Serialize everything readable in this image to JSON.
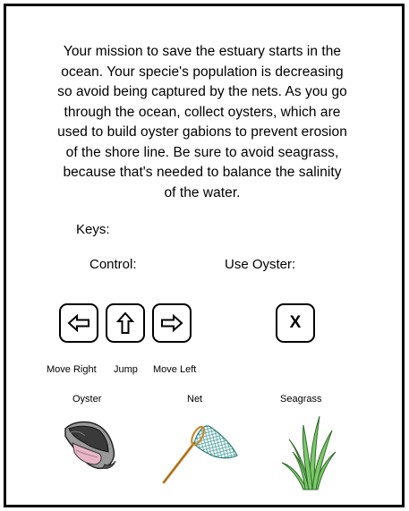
{
  "intro": {
    "lines": [
      "Your mission to save the estuary starts in the",
      "ocean. Your specie's population is decreasing",
      "so avoid being captured by the nets. As you go",
      "through the ocean, collect oysters, which are",
      "used to build oyster gabions to prevent erosion",
      "of the shore line. Be sure to avoid seagrass,",
      "because that's needed to balance the salinity",
      "of the water."
    ]
  },
  "keys_heading": "Keys:",
  "control_label": "Control:",
  "use_oyster_label": "Use Oyster:",
  "controls": {
    "left_caption": "Move Right",
    "up_caption": "Jump",
    "right_caption": "Move Left",
    "left_icon": "left-arrow-icon",
    "up_icon": "up-arrow-icon",
    "right_icon": "right-arrow-icon"
  },
  "use_key": {
    "glyph": "X"
  },
  "items": {
    "oyster": "Oyster",
    "net": "Net",
    "seagrass": "Seagrass"
  },
  "colors": {
    "frame": "#000000",
    "net_mesh": "#4fa3a0",
    "net_handle": "#c9892e",
    "seagrass": "#7cc96a",
    "oyster_pink": "#e8b7c7",
    "oyster_shell": "#3a3a3a"
  }
}
